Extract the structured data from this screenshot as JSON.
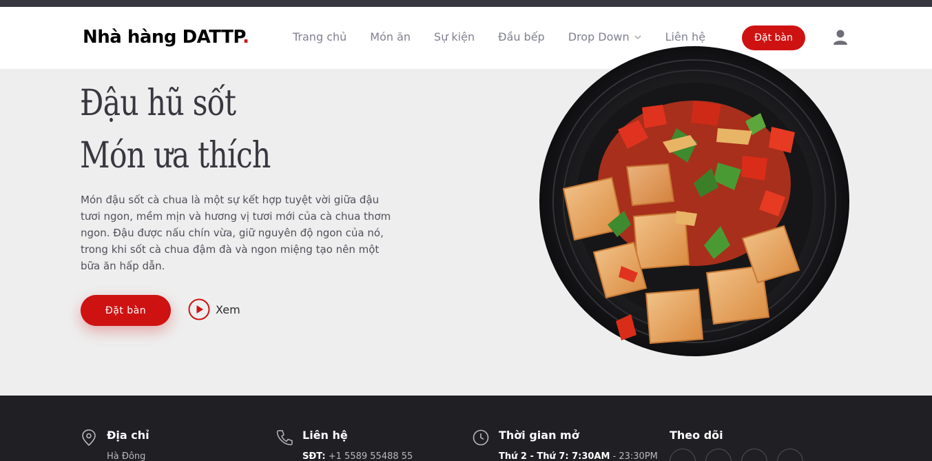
{
  "header": {
    "logo_text": "Nhà hàng DATTP",
    "logo_dot": ".",
    "nav": [
      {
        "label": "Trang chủ"
      },
      {
        "label": "Món ăn"
      },
      {
        "label": "Sự kiện"
      },
      {
        "label": "Đầu bếp"
      },
      {
        "label": "Drop Down"
      },
      {
        "label": "Liên hệ"
      }
    ],
    "book_label": "Đặt bàn",
    "user_icon": "user-icon"
  },
  "hero": {
    "title_line1": "Đậu hũ sốt",
    "title_line2": "Món ưa thích",
    "description": "Món đậu sốt cà chua là một sự kết hợp tuyệt vời giữa đậu tươi ngon, mềm mịn và hương vị tươi mới của cà chua thơm ngon. Đậu được nấu chín vừa, giữ nguyên độ ngon của nó, trong khi sốt cà chua đậm đà và ngon miệng tạo nên một bữa ăn hấp dẫn.",
    "book_label": "Đặt bàn",
    "watch_label": "Xem"
  },
  "footer": {
    "address": {
      "heading": "Địa chỉ",
      "text": "Hà Đông"
    },
    "contact": {
      "heading": "Liên hệ",
      "label": "SĐT:",
      "text": "+1 5589 55488 55"
    },
    "hours": {
      "heading": "Thời gian mở",
      "label": "Thứ 2 - Thứ 7: 7:30AM",
      "text": " - 23:30PM"
    },
    "follow": {
      "heading": "Theo dõi"
    }
  },
  "colors": {
    "accent": "#ce1212",
    "header_bg": "#ffffff",
    "hero_bg": "#eeeeee",
    "footer_bg": "#1f1f24"
  }
}
